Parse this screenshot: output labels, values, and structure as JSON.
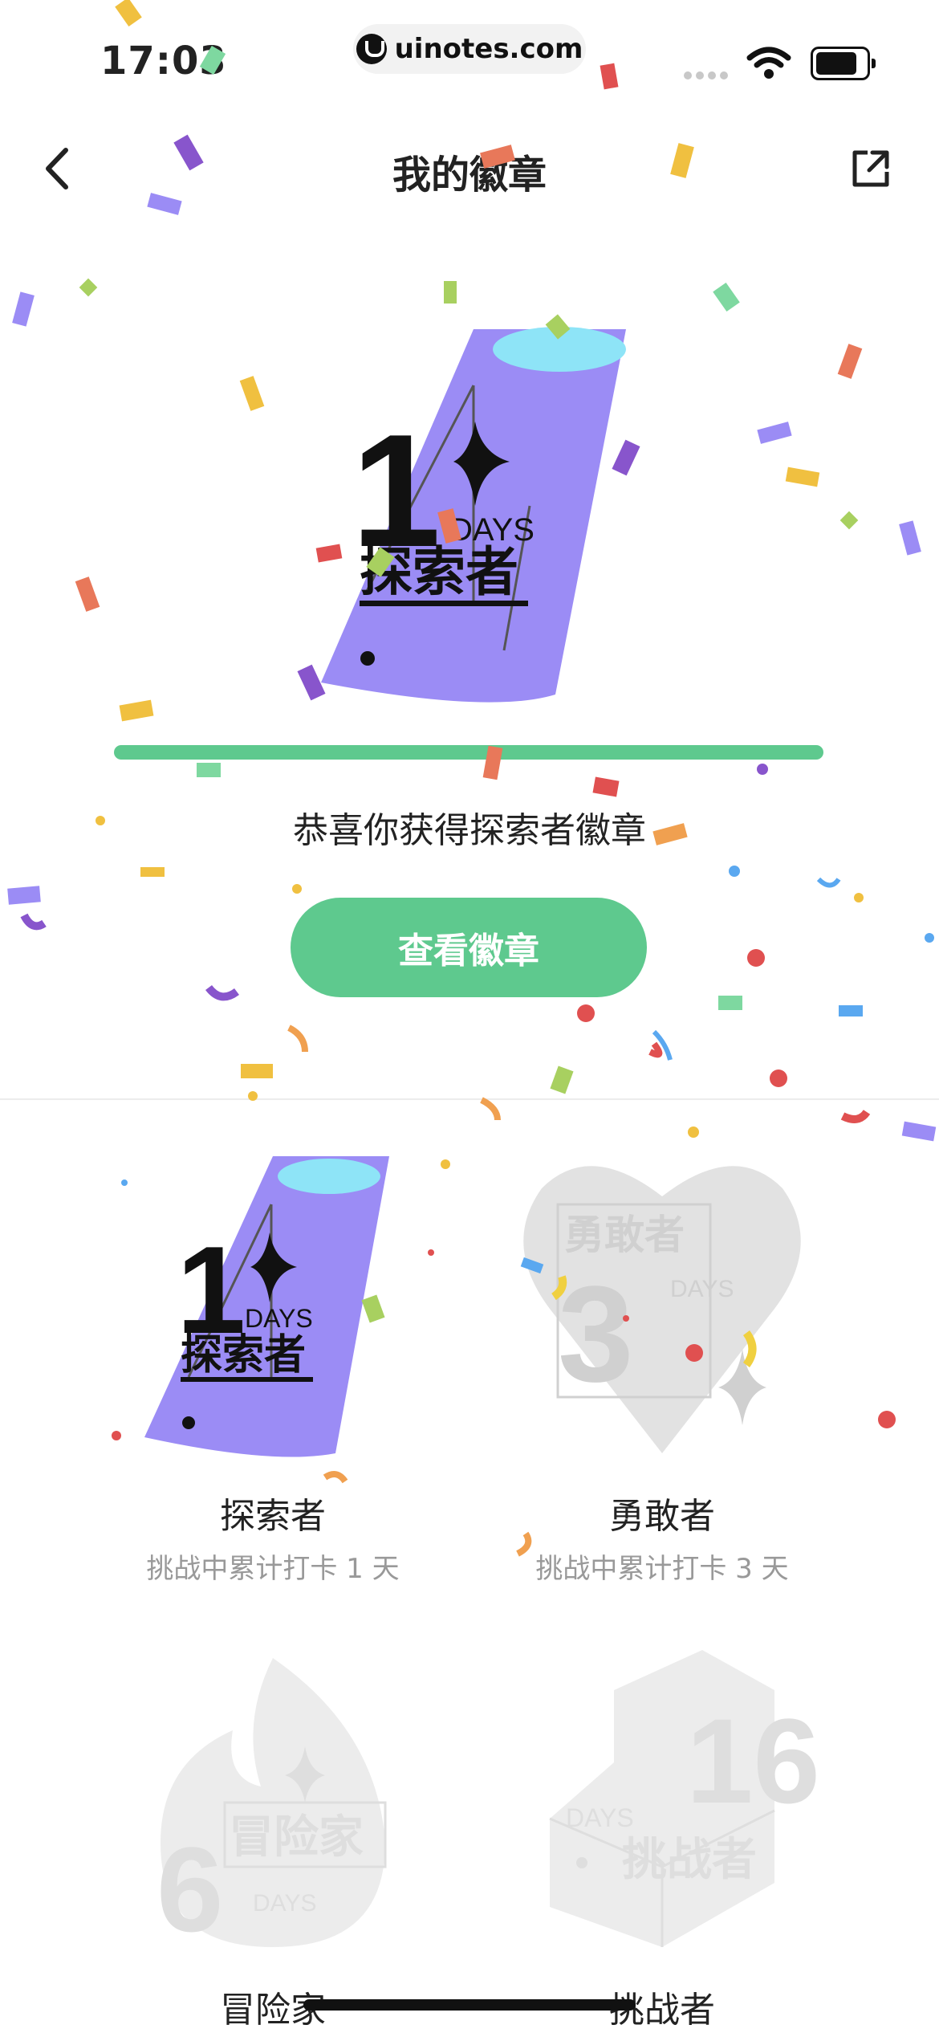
{
  "status_bar": {
    "time": "17:03",
    "url": "uinotes.com"
  },
  "nav": {
    "title": "我的徽章"
  },
  "hero": {
    "badge": {
      "number": "1",
      "days": "DAYS",
      "title": "探索者"
    },
    "progress": 1.0,
    "congrats_text": "恭喜你获得探索者徽章",
    "view_button": "查看徽章"
  },
  "badges": [
    {
      "name": "探索者",
      "desc": "挑战中累计打卡 1 天",
      "days": "1",
      "earned": true
    },
    {
      "name": "勇敢者",
      "desc": "挑战中累计打卡 3 天",
      "days": "3",
      "earned": false
    },
    {
      "name": "冒险家",
      "desc": "",
      "days": "6",
      "earned": false
    },
    {
      "name": "挑战者",
      "desc": "",
      "days": "16",
      "earned": false
    }
  ],
  "colors": {
    "accent_green": "#5ec98e",
    "badge_purple": "#9b8cf5",
    "badge_cyan": "#8ee4f7",
    "locked_gray": "#e2e2e2"
  }
}
